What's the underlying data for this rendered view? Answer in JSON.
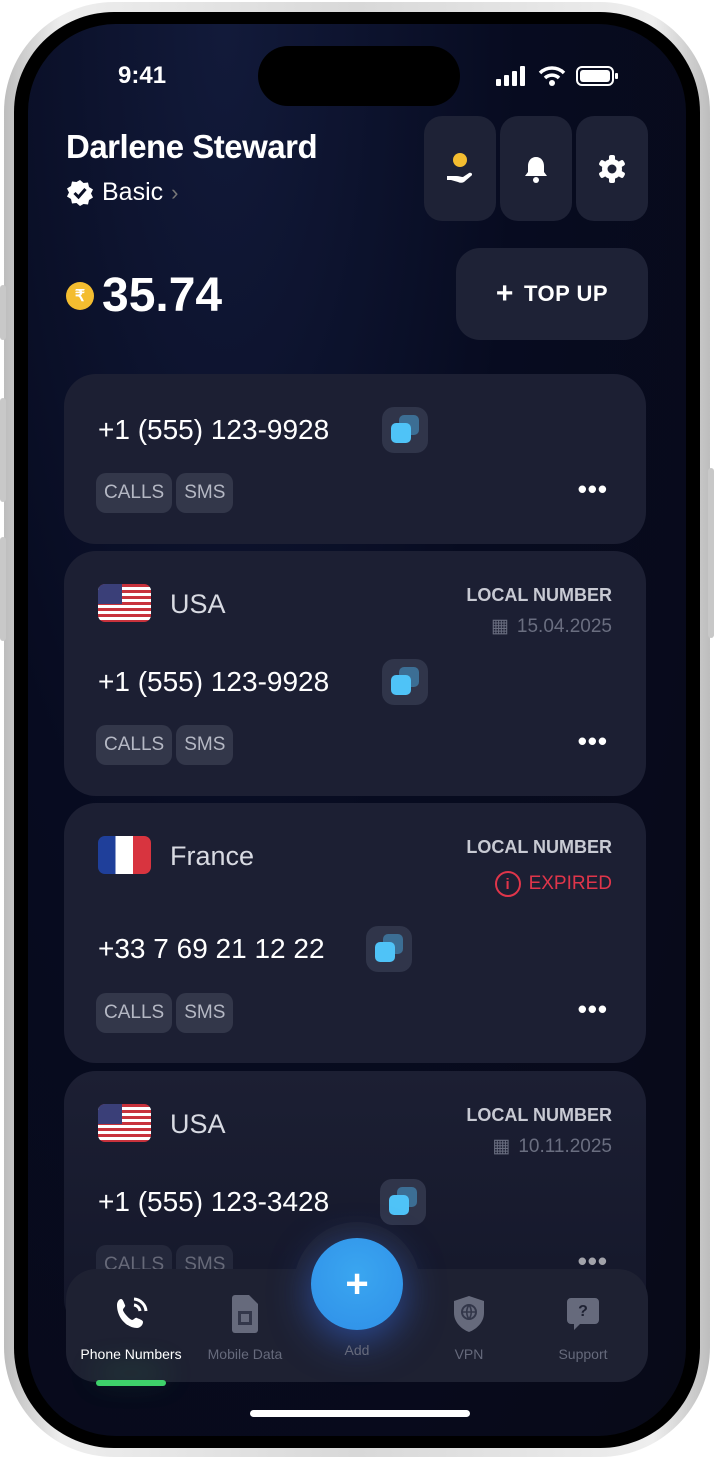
{
  "status": {
    "time": "9:41"
  },
  "header": {
    "name": "Darlene Steward",
    "plan": "Basic",
    "balance": "35.74",
    "topup_label": "TOP UP"
  },
  "numbers": [
    {
      "number": "+1 (555) 123-9928",
      "tags": [
        "CALLS",
        "SMS"
      ]
    },
    {
      "country": "USA",
      "flag": "us",
      "kind": "LOCAL NUMBER",
      "date": "15.04.2025",
      "number": "+1 (555) 123-9928",
      "tags": [
        "CALLS",
        "SMS"
      ]
    },
    {
      "country": "France",
      "flag": "fr",
      "kind": "LOCAL NUMBER",
      "status": "EXPIRED",
      "number": "+33 7 69 21 12 22",
      "tags": [
        "CALLS",
        "SMS"
      ]
    },
    {
      "country": "USA",
      "flag": "us",
      "kind": "LOCAL NUMBER",
      "date": "10.11.2025",
      "number": "+1 (555) 123-3428",
      "tags": [
        "CALLS",
        "SMS"
      ]
    }
  ],
  "nav": {
    "items": [
      {
        "label": "Phone Numbers",
        "active": true
      },
      {
        "label": "Mobile Data"
      },
      {
        "label": "Add"
      },
      {
        "label": "VPN"
      },
      {
        "label": "Support"
      }
    ]
  },
  "colors": {
    "accent": "#2f9bec",
    "active_indicator": "#3ed16a",
    "expired": "#e0354a",
    "coin": "#f4bd30"
  }
}
